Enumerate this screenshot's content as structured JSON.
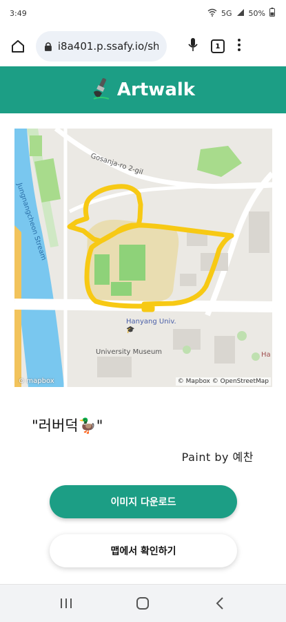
{
  "status_bar": {
    "time": "3:49",
    "network": "5G",
    "battery": "50%"
  },
  "browser": {
    "url": "i8a401.p.ssafy.io/sh",
    "tab_count": "1"
  },
  "header": {
    "title": "Artwalk"
  },
  "map": {
    "labels": {
      "road": "Gosanja-ro 2-gil",
      "stream": "Jungnangcheon Stream",
      "university": "Hanyang Univ.",
      "museum": "University Museum",
      "edge_label": "Ha"
    },
    "logo": "mapbox",
    "attribution": "© Mapbox © OpenStreetMap",
    "route_color": "#f7c914"
  },
  "artwork": {
    "title": "\"러버덕🦆\"",
    "painter": "Paint by 예찬"
  },
  "buttons": {
    "download": "이미지 다운로드",
    "view_on_map": "맵에서 확인하기"
  },
  "colors": {
    "primary": "#1c9e85"
  }
}
